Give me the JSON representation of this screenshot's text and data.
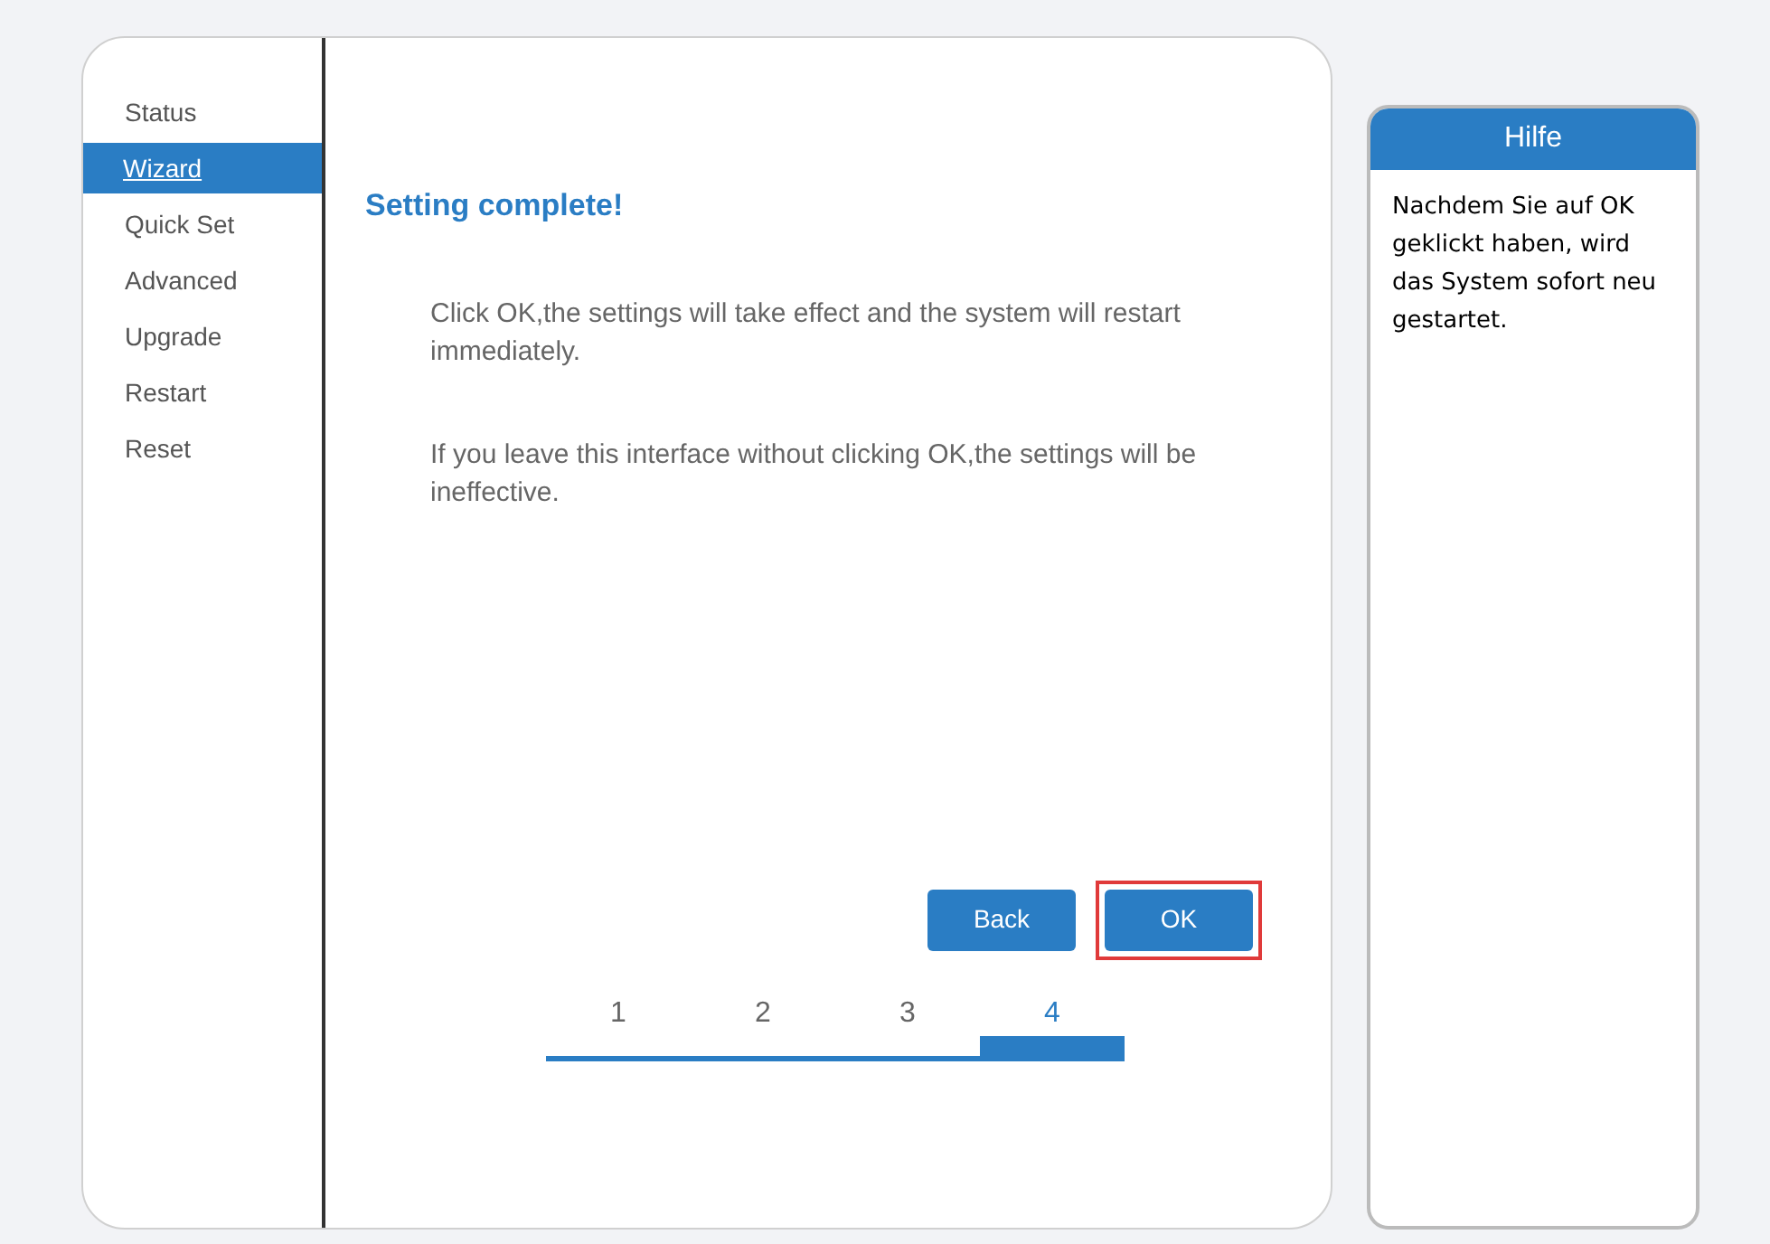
{
  "sidebar": {
    "items": [
      {
        "label": "Status",
        "selected": false
      },
      {
        "label": "Wizard",
        "selected": true
      },
      {
        "label": "Quick Set",
        "selected": false
      },
      {
        "label": "Advanced",
        "selected": false
      },
      {
        "label": "Upgrade",
        "selected": false
      },
      {
        "label": "Restart",
        "selected": false
      },
      {
        "label": "Reset",
        "selected": false
      }
    ]
  },
  "content": {
    "heading": "Setting complete!",
    "paragraphs": [
      "Click OK,the settings will take effect and the system will restart immediately.",
      "If you leave this interface without clicking OK,the settings will be ineffective."
    ],
    "buttons": [
      {
        "label": "Back",
        "highlighted": false
      },
      {
        "label": "OK",
        "highlighted": true
      }
    ],
    "steps": [
      {
        "label": "1",
        "selected": false
      },
      {
        "label": "2",
        "selected": false
      },
      {
        "label": "3",
        "selected": false
      },
      {
        "label": "4",
        "selected": true
      }
    ]
  },
  "help": {
    "title": "Hilfe",
    "text": "Nachdem Sie auf OK geklickt haben, wird das System sofort neu gestartet."
  }
}
